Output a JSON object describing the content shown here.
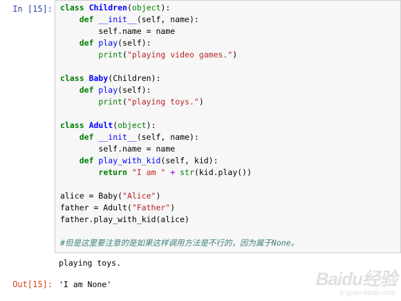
{
  "input_prompt": "In  [15]:",
  "output_prompt": "Out[15]:",
  "stdout_text": "playing toys.",
  "result_text": "'I am None'",
  "watermark": {
    "brand": "Baidu经验",
    "url": "jingyan.baidu.com"
  },
  "code": {
    "l1": {
      "kw": "class",
      "name": "Children",
      "open": "(",
      "base": "object",
      "close": "):"
    },
    "l2": {
      "kw": "def",
      "name": "__init__",
      "args": "(self, name):"
    },
    "l3": {
      "text": "self.name = name"
    },
    "l4": {
      "kw": "def",
      "name": "play",
      "args": "(self):"
    },
    "l5": {
      "fn": "print",
      "open": "(",
      "str": "\"playing video games.\"",
      "close": ")"
    },
    "l7": {
      "kw": "class",
      "name": "Baby",
      "open": "(",
      "base": "Children",
      "close": "):"
    },
    "l8": {
      "kw": "def",
      "name": "play",
      "args": "(self):"
    },
    "l9": {
      "fn": "print",
      "open": "(",
      "str": "\"playing toys.\"",
      "close": ")"
    },
    "l11": {
      "kw": "class",
      "name": "Adult",
      "open": "(",
      "base": "object",
      "close": "):"
    },
    "l12": {
      "kw": "def",
      "name": "__init__",
      "args": "(self, name):"
    },
    "l13": {
      "text": "self.name = name"
    },
    "l14": {
      "kw": "def",
      "name": "play_with_kid",
      "args": "(self, kid):"
    },
    "l15": {
      "kw": "return",
      "str": "\"I am \"",
      "op": "+",
      "fn": "str",
      "rest": "(kid.play())"
    },
    "l17": {
      "pre": "alice = Baby(",
      "str": "\"Alice\"",
      "post": ")"
    },
    "l18": {
      "pre": "father = Adult(",
      "str": "\"Father\"",
      "post": ")"
    },
    "l19": {
      "text": "father.play_with_kid(alice)"
    },
    "l21": {
      "comment": "#但是这里要注意的是如果这样调用方法是不行的，因为属于None。"
    }
  }
}
